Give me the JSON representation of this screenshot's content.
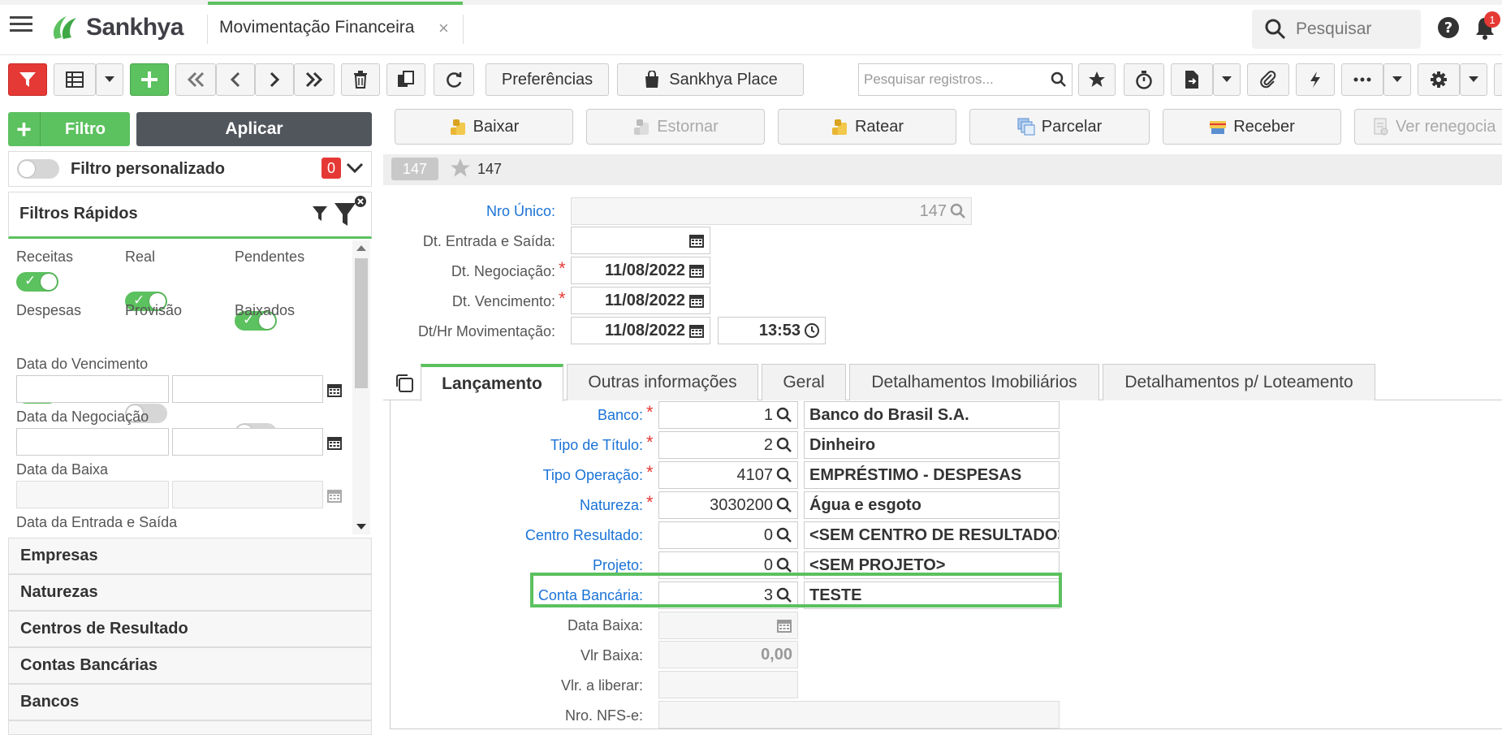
{
  "header": {
    "brand": "Sankhya",
    "tab_title": "Movimentação Financeira",
    "tab_close": "×",
    "search_placeholder": "Pesquisar",
    "notification_count": "1"
  },
  "toolbar": {
    "preferences_label": "Preferências",
    "place_label": "Sankhya Place",
    "search_records_placeholder": "Pesquisar registros..."
  },
  "filter_panel": {
    "filtro_label": "Filtro",
    "plus": "+",
    "aplicar_label": "Aplicar",
    "personalizado_label": "Filtro personalizado",
    "personalizado_count": "0",
    "rapidos_title": "Filtros Rápidos",
    "toggles": [
      {
        "label": "Receitas",
        "on": true
      },
      {
        "label": "Real",
        "on": true
      },
      {
        "label": "Pendentes",
        "on": true
      },
      {
        "label": "Despesas",
        "on": true
      },
      {
        "label": "Provisão",
        "on": false
      },
      {
        "label": "Baixados",
        "on": false
      }
    ],
    "date_filters": [
      "Data do Vencimento",
      "Data da Negociação",
      "Data da Baixa",
      "Data da Entrada e Saída"
    ],
    "sections": [
      "Empresas",
      "Naturezas",
      "Centros de Resultado",
      "Contas Bancárias",
      "Bancos"
    ]
  },
  "actions": {
    "baixar": "Baixar",
    "estornar": "Estornar",
    "ratear": "Ratear",
    "parcelar": "Parcelar",
    "receber": "Receber",
    "ver_renegociacao": "Ver renegocia"
  },
  "record": {
    "chip": "147",
    "number": "147"
  },
  "form": {
    "nro_unico_label": "Nro Único:",
    "nro_unico": "147",
    "dt_entrada_label": "Dt. Entrada e Saída:",
    "dt_negociacao_label": "Dt. Negociação:",
    "dt_negociacao": "11/08/2022",
    "dt_vencimento_label": "Dt. Vencimento:",
    "dt_vencimento": "11/08/2022",
    "dt_mov_label": "Dt/Hr Movimentação:",
    "dt_mov": "11/08/2022",
    "hr_mov": "13:53",
    "required_mark": "*"
  },
  "tabs": [
    "Lançamento",
    "Outras informações",
    "Geral",
    "Detalhamentos Imobiliários",
    "Detalhamentos p/ Loteamento"
  ],
  "lancamento": {
    "banco_label": "Banco:",
    "banco_code": "1",
    "banco_name": "Banco do Brasil S.A.",
    "tipo_titulo_label": "Tipo de Título:",
    "tipo_titulo_code": "2",
    "tipo_titulo_name": "Dinheiro",
    "tipo_operacao_label": "Tipo Operação:",
    "tipo_operacao_code": "4107",
    "tipo_operacao_name": "EMPRÉSTIMO - DESPESAS",
    "natureza_label": "Natureza:",
    "natureza_code": "3030200",
    "natureza_name": "Água e esgoto",
    "centro_label": "Centro Resultado:",
    "centro_code": "0",
    "centro_name": "<SEM CENTRO DE RESULTADO>",
    "projeto_label": "Projeto:",
    "projeto_code": "0",
    "projeto_name": "<SEM PROJETO>",
    "conta_label": "Conta Bancária:",
    "conta_code": "3",
    "conta_name": "TESTE",
    "data_baixa_label": "Data Baixa:",
    "vlr_baixa_label": "Vlr Baixa:",
    "vlr_baixa": "0,00",
    "vlr_liberar_label": "Vlr. a liberar:",
    "nfse_label": "Nro. NFS-e:"
  },
  "colors": {
    "accent": "#5cc15f",
    "filter_red": "#e53935",
    "link": "#1a73d6",
    "dark_button": "#51565d"
  }
}
